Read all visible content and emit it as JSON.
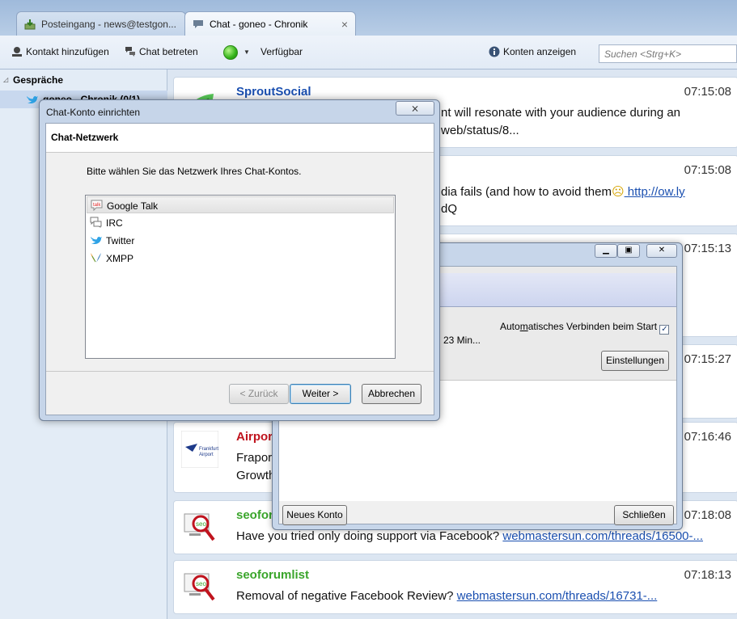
{
  "tabs": [
    {
      "label": "Posteingang - news@testgon..."
    },
    {
      "label": "Chat - goneo - Chronik",
      "close": "×"
    }
  ],
  "toolbar": {
    "add_contact": "Kontakt hinzufügen",
    "join_chat": "Chat betreten",
    "status": "Verfügbar",
    "show_accounts": "Konten anzeigen",
    "search_placeholder": "Suchen <Strg+K>"
  },
  "sidebar": {
    "group_title": "Gespräche",
    "conversation": "goneo - Chronik (0/1)"
  },
  "messages": [
    {
      "sender": "SproutSocial",
      "time": "07:15:08",
      "line1": "You need to be sure the style of content will resonate with your audience during an",
      "line1_visible": "nt will resonate with your audience during an",
      "link": "web/status/8..."
    },
    {
      "sender": "",
      "time": "07:15:08",
      "line1_visible": "dia fails (and how to avoid them",
      "link": " http://ow.ly",
      "line2_link": "dQ"
    },
    {
      "sender": "",
      "time": "07:15:13"
    },
    {
      "sender": "",
      "time": "07:15:27"
    },
    {
      "sender": "Airport_",
      "time": "07:16:46",
      "line1": "Fraport",
      "line2": "Growth"
    },
    {
      "sender": "seoforumlist",
      "time": "07:18:08",
      "text": "Have you tried only doing support via Facebook?",
      "link": "webmastersun.com/threads/16500-..."
    },
    {
      "sender": "seoforumlist",
      "time": "07:18:13",
      "text": "Removal of negative Facebook Review?",
      "link": "webmastersun.com/threads/16731-..."
    }
  ],
  "accounts_window": {
    "auto_connect": "Automatisches Verbinden beim Start",
    "auto_connect_prefix": "Auto",
    "auto_connect_underlined": "m",
    "auto_connect_suffix": "atisches Verbinden beim Start",
    "connected_for": "23 Min...",
    "settings_button": "Einstellungen",
    "new_account_button": "Neues Konto",
    "close_button": "Schließen"
  },
  "setup_dialog": {
    "title": "Chat-Konto einrichten",
    "header": "Chat-Netzwerk",
    "prompt": "Bitte wählen Sie das Netzwerk Ihres Chat-Kontos.",
    "networks": [
      "Google Talk",
      "IRC",
      "Twitter",
      "XMPP"
    ],
    "selected_network": "Google Talk",
    "back_button": "< Zurück",
    "next_button": "Weiter >",
    "cancel_button": "Abbrechen",
    "close_glyph": "⨯"
  },
  "colors": {
    "sender_blue": "#1a4fb0",
    "sender_red": "#c0141e",
    "sender_green": "#3aa52b",
    "link": "#1a4fb0"
  }
}
